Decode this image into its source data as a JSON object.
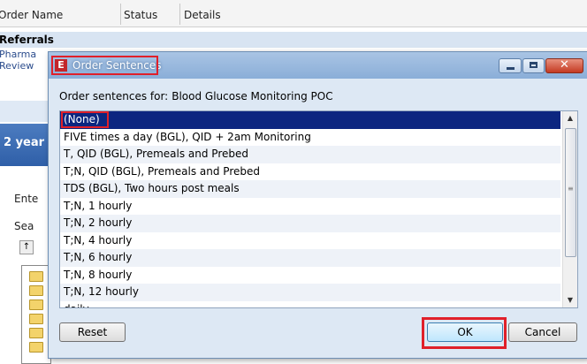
{
  "background": {
    "columns": [
      "Order Name",
      "Status",
      "Details"
    ],
    "referrals": "Referrals",
    "left_items": [
      "Pharma",
      "Review"
    ],
    "age_text": "2 year",
    "labels": [
      "Ente",
      "Sea"
    ]
  },
  "dialog": {
    "title": "Order Sentences",
    "app_icon_letter": "E",
    "prompt_label": "Order sentences for:",
    "prompt_value": "Blood Glucose Monitoring POC",
    "sentences": [
      "(None)",
      "FIVE times a day (BGL), QID + 2am Monitoring",
      "T, QID (BGL), Premeals and Prebed",
      "T;N, QID (BGL), Premeals and Prebed",
      "TDS (BGL), Two hours post meals",
      "T;N, 1 hourly",
      "T;N, 2 hourly",
      "T;N, 4 hourly",
      "T;N, 6 hourly",
      "T;N, 8 hourly",
      "T;N, 12 hourly",
      "daily"
    ],
    "selected_index": 0,
    "buttons": {
      "reset": "Reset",
      "ok": "OK",
      "cancel": "Cancel"
    }
  },
  "colors": {
    "selection": "#0c2680",
    "highlight_outline": "#e0202a",
    "dialog_bg": "#dde8f4"
  }
}
